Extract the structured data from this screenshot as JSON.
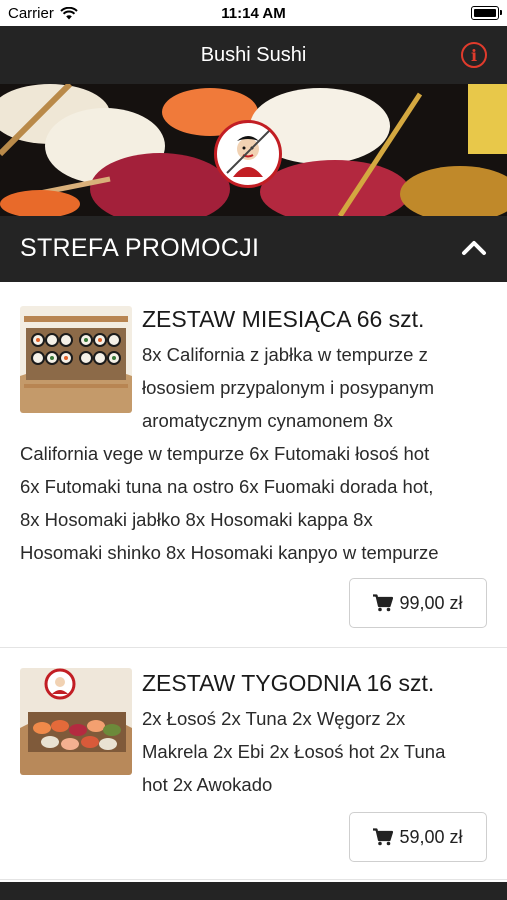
{
  "status_bar": {
    "carrier": "Carrier",
    "time": "11:14 AM"
  },
  "nav": {
    "title": "Bushi Sushi",
    "info_icon": "info-icon"
  },
  "section": {
    "title": "STREFA PROMOCJI",
    "toggle_icon": "chevron-up-icon"
  },
  "products": [
    {
      "name": "ZESTAW MIESIĄCA 66 szt.",
      "description_lines": [
        "8x California z jabłka w tempurze z",
        "łososiem przypalonym i posypanym",
        "aromatycznym cynamonem 8x",
        "California vege w tempurze 6x Futomaki łosoś hot",
        "6x Futomaki tuna na ostro 6x Fuomaki dorada hot,",
        "8x Hosomaki jabłko 8x Hosomaki kappa 8x",
        "Hosomaki shinko 8x Hosomaki kanpyo w tempurze"
      ],
      "price": "99,00 zł",
      "cart_icon": "cart-icon"
    },
    {
      "name": "ZESTAW TYGODNIA 16 szt.",
      "description_lines": [
        "2x Łosoś 2x Tuna 2x Węgorz 2x",
        "Makrela 2x Ebi 2x Łosoś hot 2x Tuna",
        "hot 2x Awokado"
      ],
      "price": "59,00 zł",
      "cart_icon": "cart-icon"
    }
  ],
  "colors": {
    "dark_bar": "#242424",
    "accent_red": "#e03b2c"
  }
}
